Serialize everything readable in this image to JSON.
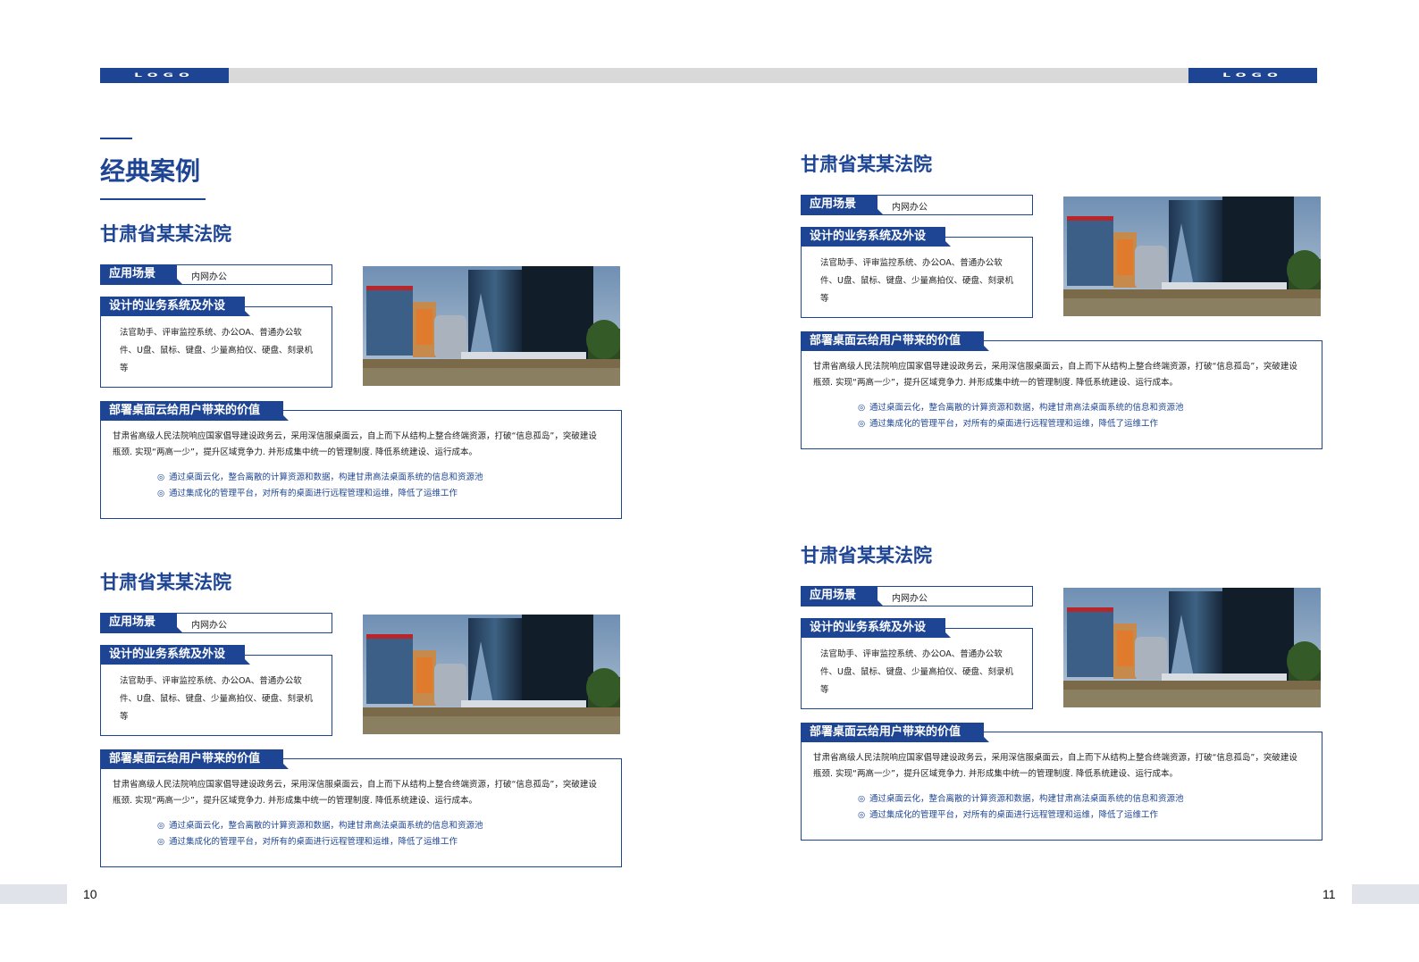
{
  "header": {
    "logo_left": "LOGO",
    "logo_right": "LOGO"
  },
  "section_title": "经典案例",
  "cases": [
    {
      "title": "甘肃省某某法院",
      "scene_label": "应用场景",
      "scene_value": "内网办公",
      "system_label": "设计的业务系统及外设",
      "system_text": "法官助手、评审监控系统、办公OA、普通办公软件、U盘、鼠标、键盘、少量高拍仪、硬盘、刻录机等",
      "value_label": "部署桌面云给用户带来的价值",
      "value_text": "甘肃省高级人民法院响应国家倡导建设政务云，采用深信服桌面云，自上而下从结构上整合终端资源，打破“信息孤岛”，突破建设瓶颈. 实现“两高一少”，提升区域竞争力. 并形成集中统一的管理制度. 降低系统建设、运行成本。",
      "bullets": [
        "通过桌面云化，整合离散的计算资源和数据，构建甘肃高法桌面系统的信息和资源池",
        "通过集成化的管理平台，对所有的桌面进行远程管理和运维，降低了运维工作"
      ]
    },
    {
      "title": "甘肃省某某法院",
      "scene_label": "应用场景",
      "scene_value": "内网办公",
      "system_label": "设计的业务系统及外设",
      "system_text": "法官助手、评审监控系统、办公OA、普通办公软件、U盘、鼠标、键盘、少量高拍仪、硬盘、刻录机等",
      "value_label": "部署桌面云给用户带来的价值",
      "value_text": "甘肃省高级人民法院响应国家倡导建设政务云，采用深信服桌面云，自上而下从结构上整合终端资源，打破“信息孤岛”，突破建设瓶颈. 实现“两高一少”，提升区域竞争力. 并形成集中统一的管理制度. 降低系统建设、运行成本。",
      "bullets": [
        "通过桌面云化，整合离散的计算资源和数据，构建甘肃高法桌面系统的信息和资源池",
        "通过集成化的管理平台，对所有的桌面进行远程管理和运维，降低了运维工作"
      ]
    },
    {
      "title": "甘肃省某某法院",
      "scene_label": "应用场景",
      "scene_value": "内网办公",
      "system_label": "设计的业务系统及外设",
      "system_text": "法官助手、评审监控系统、办公OA、普通办公软件、U盘、鼠标、键盘、少量高拍仪、硬盘、刻录机等",
      "value_label": "部署桌面云给用户带来的价值",
      "value_text": "甘肃省高级人民法院响应国家倡导建设政务云，采用深信服桌面云，自上而下从结构上整合终端资源，打破“信息孤岛”，突破建设瓶颈. 实现“两高一少”，提升区域竞争力. 并形成集中统一的管理制度. 降低系统建设、运行成本。",
      "bullets": [
        "通过桌面云化，整合离散的计算资源和数据，构建甘肃高法桌面系统的信息和资源池",
        "通过集成化的管理平台，对所有的桌面进行远程管理和运维，降低了运维工作"
      ]
    },
    {
      "title": "甘肃省某某法院",
      "scene_label": "应用场景",
      "scene_value": "内网办公",
      "system_label": "设计的业务系统及外设",
      "system_text": "法官助手、评审监控系统、办公OA、普通办公软件、U盘、鼠标、键盘、少量高拍仪、硬盘、刻录机等",
      "value_label": "部署桌面云给用户带来的价值",
      "value_text": "甘肃省高级人民法院响应国家倡导建设政务云，采用深信服桌面云，自上而下从结构上整合终端资源，打破“信息孤岛”，突破建设瓶颈. 实现“两高一少”，提升区域竞争力. 并形成集中统一的管理制度. 降低系统建设、运行成本。",
      "bullets": [
        "通过桌面云化，整合离散的计算资源和数据，构建甘肃高法桌面系统的信息和资源池",
        "通过集成化的管理平台，对所有的桌面进行远程管理和运维，降低了运维工作"
      ]
    }
  ],
  "footer": {
    "page_left": "10",
    "page_right": "11"
  },
  "colors": {
    "brand": "#1e4594",
    "bar": "#d9d9d9",
    "footer_bar": "#e1e3eb"
  },
  "icons": {
    "bullet": "circle-bullet-icon"
  }
}
